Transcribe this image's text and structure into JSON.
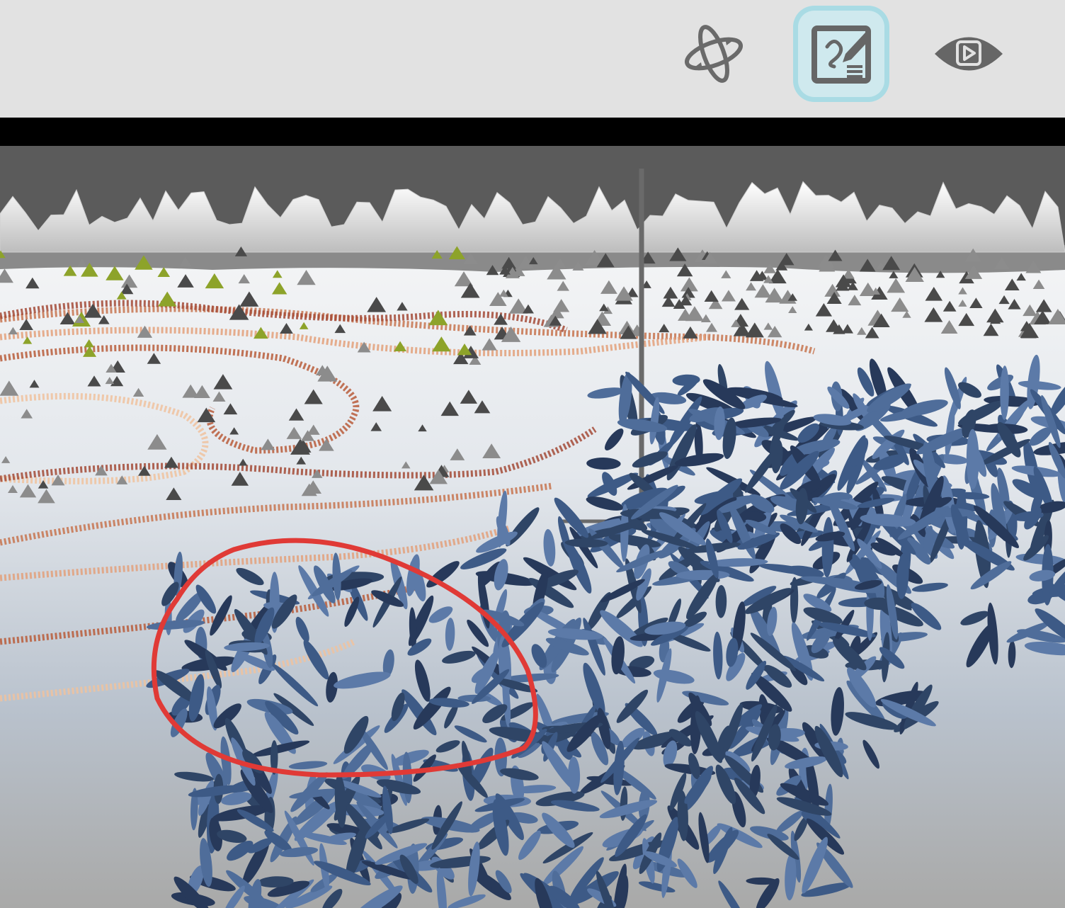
{
  "toolbar": {
    "tools": [
      {
        "icon": "orbit-icon",
        "state": "inactive"
      },
      {
        "icon": "edit-pen-icon",
        "state": "active"
      },
      {
        "icon": "preview-eye-icon",
        "state": "inactive"
      }
    ],
    "active_highlight_color": "#a9dbe4",
    "icon_color": "#666666"
  },
  "viewport": {
    "annotation_color": "#e03a36",
    "crystal_color": "#3d5a86",
    "fence_color": "#c7744f"
  }
}
